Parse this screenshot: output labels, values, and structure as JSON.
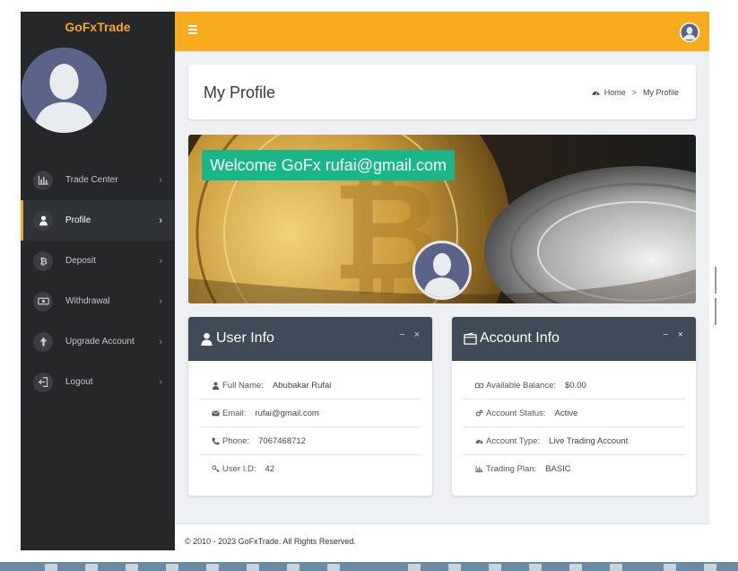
{
  "brand": {
    "name": "GoFxTrade",
    "color": "#f5a623"
  },
  "colors": {
    "topbar": "#f8ab1d",
    "sidebar": "#252729",
    "card_header": "#404b5a",
    "welcome_badge": "#19b788"
  },
  "sidebar": {
    "items": [
      {
        "label": "Trade Center",
        "icon": "bar-chart-icon"
      },
      {
        "label": "Profile",
        "icon": "user-icon",
        "active": true
      },
      {
        "label": "Deposit",
        "icon": "bitcoin-icon"
      },
      {
        "label": "Withdrawal",
        "icon": "money-bill-icon"
      },
      {
        "label": "Upgrade Account",
        "icon": "arrow-up-icon"
      },
      {
        "label": "Logout",
        "icon": "sign-out-icon"
      }
    ]
  },
  "header": {
    "title": "My Profile",
    "breadcrumb": {
      "home": "Home",
      "separator": ">",
      "current": "My Profile"
    }
  },
  "banner": {
    "welcome": "Welcome GoFx rufai@gmail.com"
  },
  "user_info": {
    "title": "User Info",
    "tools": {
      "minimize": "−",
      "close": "×"
    },
    "rows": [
      {
        "label": "Full Name:",
        "value": "Abubakar Rufai",
        "icon": "user-icon"
      },
      {
        "label": "Email:",
        "value": "rufai@gmail.com",
        "icon": "envelope-icon"
      },
      {
        "label": "Phone:",
        "value": "7067468712",
        "icon": "phone-icon"
      },
      {
        "label": "User I.D:",
        "value": "42",
        "icon": "key-icon"
      }
    ]
  },
  "account_info": {
    "title": "Account Info",
    "tools": {
      "minimize": "−",
      "close": "×"
    },
    "rows": [
      {
        "label": "Available Balance:",
        "value": "$0.00",
        "icon": "money-icon"
      },
      {
        "label": "Account Status:",
        "value": "Active",
        "icon": "gears-icon"
      },
      {
        "label": "Account Type:",
        "value": "Live Trading Account",
        "icon": "dashboard-icon"
      },
      {
        "label": "Trading Plan:",
        "value": "BASIC",
        "icon": "bar-chart-icon"
      }
    ]
  },
  "footer": {
    "text": "© 2010 - 2023 GoFxTrade. All Rights Reserved."
  }
}
